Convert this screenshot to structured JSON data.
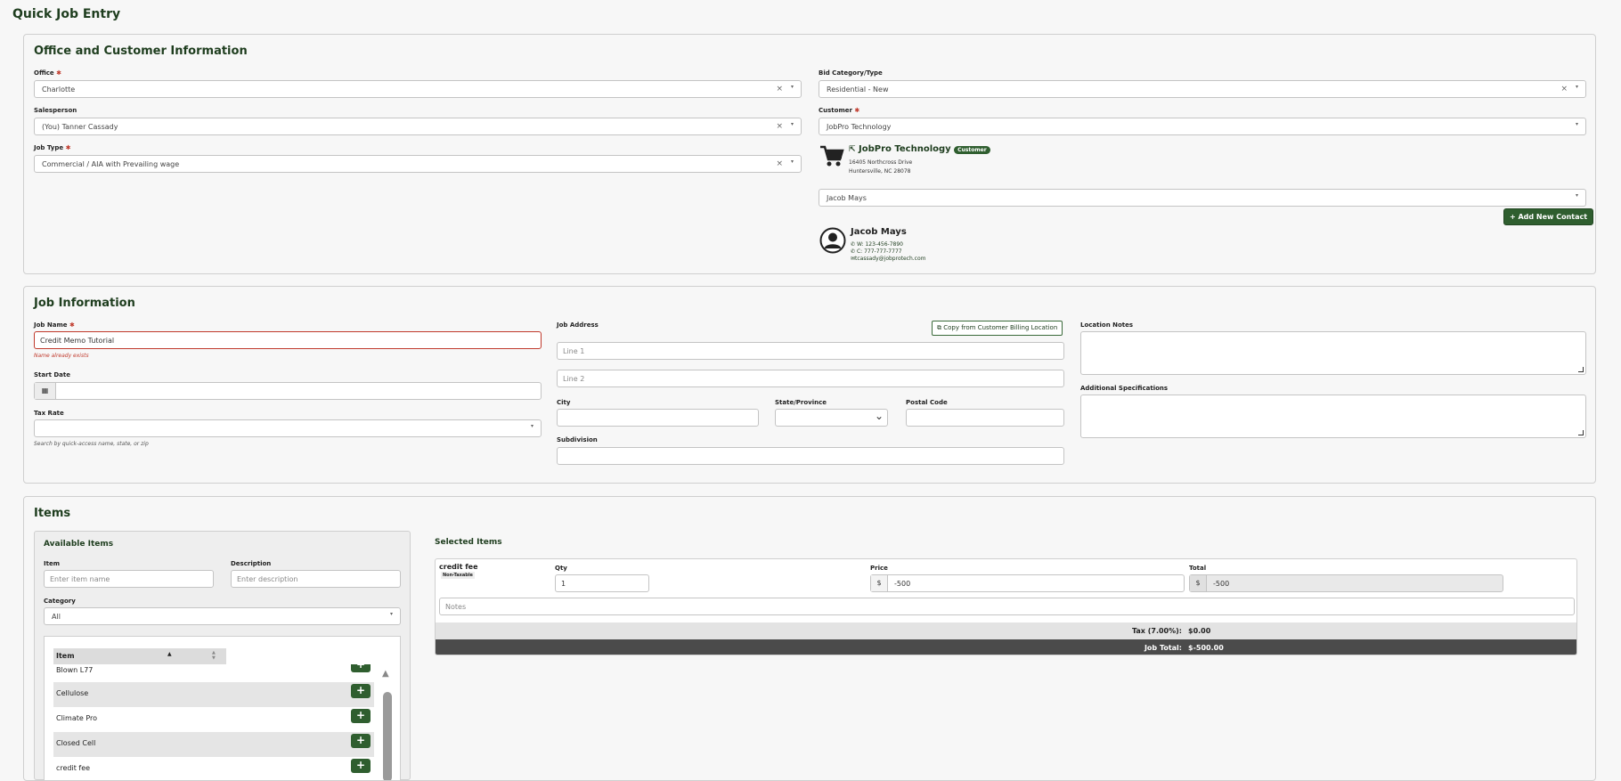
{
  "page": {
    "title": "Quick Job Entry"
  },
  "office_section": {
    "heading": "Office and Customer Information",
    "office": {
      "label": "Office",
      "value": "Charlotte"
    },
    "salesperson": {
      "label": "Salesperson",
      "value": "(You) Tanner Cassady"
    },
    "job_type": {
      "label": "Job Type",
      "value": "Commercial / AIA with Prevailing wage"
    },
    "bid_category": {
      "label": "Bid Category/Type",
      "value": "Residential - New"
    },
    "customer": {
      "label": "Customer",
      "value": "JobPro Technology"
    },
    "customer_card": {
      "name": "JobPro Technology",
      "badge": "Customer",
      "address1": "16405 Northcross Drive",
      "address2": "Huntersville, NC 28078"
    },
    "contact_select": {
      "value": "Jacob Mays"
    },
    "add_contact_label": "+ Add New Contact",
    "contact_card": {
      "name": "Jacob Mays",
      "work": "W: 123-456-7890",
      "cell": "C: 777-777-7777",
      "email": "tcassady@jobprotech.com"
    }
  },
  "job_section": {
    "heading": "Job Information",
    "job_name": {
      "label": "Job Name",
      "value": "Credit Memo Tutorial",
      "error": "Name already exists"
    },
    "start_date": {
      "label": "Start Date",
      "value": ""
    },
    "tax_rate": {
      "label": "Tax Rate",
      "value": "",
      "hint": "Search by quick-access name, state, or zip"
    },
    "job_address": {
      "label": "Job Address",
      "copy_button": "Copy from Customer Billing Location",
      "line1_placeholder": "Line 1",
      "line2_placeholder": "Line 2",
      "city_label": "City",
      "state_label": "State/Province",
      "postal_label": "Postal Code",
      "subdivision_label": "Subdivision"
    },
    "location_notes_label": "Location Notes",
    "additional_specs_label": "Additional Specifications"
  },
  "items_section": {
    "heading": "Items",
    "available": {
      "heading": "Available Items",
      "item_label": "Item",
      "item_placeholder": "Enter item name",
      "description_label": "Description",
      "description_placeholder": "Enter description",
      "category_label": "Category",
      "category_value": "All",
      "column_header": "Item",
      "rows": [
        "Blown L77",
        "Cellulose",
        "Climate Pro",
        "Closed Cell",
        "credit fee"
      ]
    },
    "selected": {
      "heading": "Selected Items",
      "item_name": "credit fee",
      "item_badge": "Non-Taxable",
      "qty_label": "Qty",
      "qty_value": "1",
      "price_label": "Price",
      "currency": "$",
      "price_value": "-500",
      "total_label": "Total",
      "total_value": "-500",
      "notes_placeholder": "Notes",
      "tax_label": "Tax (7.00%):",
      "tax_value": "$0.00",
      "job_total_label": "Job Total:",
      "job_total_value": "$-500.00"
    }
  }
}
